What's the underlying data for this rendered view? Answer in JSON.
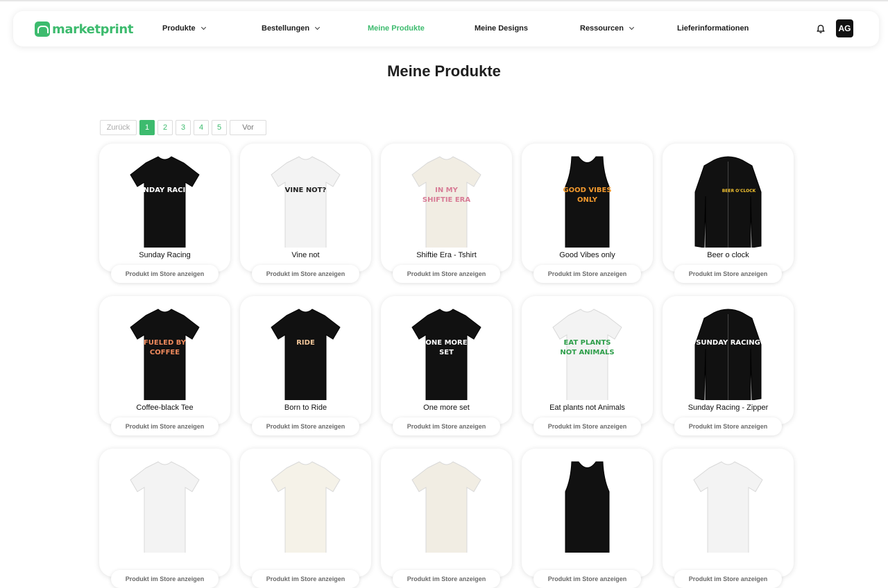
{
  "brand": {
    "name": "marketprint",
    "color": "#3dbb6e"
  },
  "nav": {
    "items": [
      {
        "label": "Produkte",
        "dropdown": true
      },
      {
        "label": "Bestellungen",
        "dropdown": true
      },
      {
        "label": "Meine Produkte",
        "active": true
      },
      {
        "label": "Meine Designs"
      },
      {
        "label": "Ressourcen",
        "dropdown": true
      },
      {
        "label": "Lieferinformationen"
      }
    ],
    "avatar": "AG"
  },
  "page": {
    "title": "Meine Produkte"
  },
  "pagination": {
    "prev": "Zurück",
    "pages": [
      "1",
      "2",
      "3",
      "4",
      "5"
    ],
    "current": "1",
    "next": "Vor"
  },
  "store_button_label": "Produkt im Store anzeigen",
  "products": [
    {
      "name": "Sunday Racing",
      "garment": "tshirt",
      "color": "#111111",
      "print": "SUNDAY RACING",
      "print_color": "#ffffff"
    },
    {
      "name": "Vine not",
      "garment": "tshirt",
      "color": "#f3f3f3",
      "print": "VINE NOT?",
      "print_color": "#222222"
    },
    {
      "name": "Shiftie Era - Tshirt",
      "garment": "tshirt",
      "color": "#f1ede3",
      "print": "IN MY SHIFTIE ERA",
      "print_color": "#d77b95"
    },
    {
      "name": "Good Vibes only",
      "garment": "tank",
      "color": "#111111",
      "print": "GOOD VIBES ONLY",
      "print_color": "#f39a2e"
    },
    {
      "name": "Beer o clock",
      "garment": "hoodie",
      "color": "#111111",
      "print": "BEER O'CLOCK",
      "print_color": "#f2c230"
    },
    {
      "name": "Coffee-black Tee",
      "garment": "tshirt",
      "color": "#111111",
      "print": "FUELED BY COFFEE",
      "print_color": "#f08a5d"
    },
    {
      "name": "Born to Ride",
      "garment": "tshirt",
      "color": "#111111",
      "print": "RIDE",
      "print_color": "#f4c79a"
    },
    {
      "name": "One more set",
      "garment": "tshirt",
      "color": "#111111",
      "print": "ONE MORE SET",
      "print_color": "#ffffff"
    },
    {
      "name": "Eat plants not Animals",
      "garment": "tshirt",
      "color": "#f3f3f3",
      "print": "EAT PLANTS NOT ANIMALS",
      "print_color": "#2e9e4a"
    },
    {
      "name": "Sunday Racing - Zipper",
      "garment": "hoodie",
      "color": "#111111",
      "print": "SUNDAY RACING",
      "print_color": "#ffffff"
    },
    {
      "name": "",
      "garment": "tshirt",
      "color": "#f3f3f3",
      "print": "",
      "print_color": "#333333"
    },
    {
      "name": "",
      "garment": "tshirt",
      "color": "#f5f2e8",
      "print": "",
      "print_color": "#e04b8f"
    },
    {
      "name": "",
      "garment": "tshirt",
      "color": "#f1ede3",
      "print": "",
      "print_color": "#333333"
    },
    {
      "name": "",
      "garment": "tank",
      "color": "#111111",
      "print": "",
      "print_color": "#ffffff"
    },
    {
      "name": "",
      "garment": "tshirt",
      "color": "#f3f3f3",
      "print": "",
      "print_color": "#f08a5d"
    }
  ]
}
